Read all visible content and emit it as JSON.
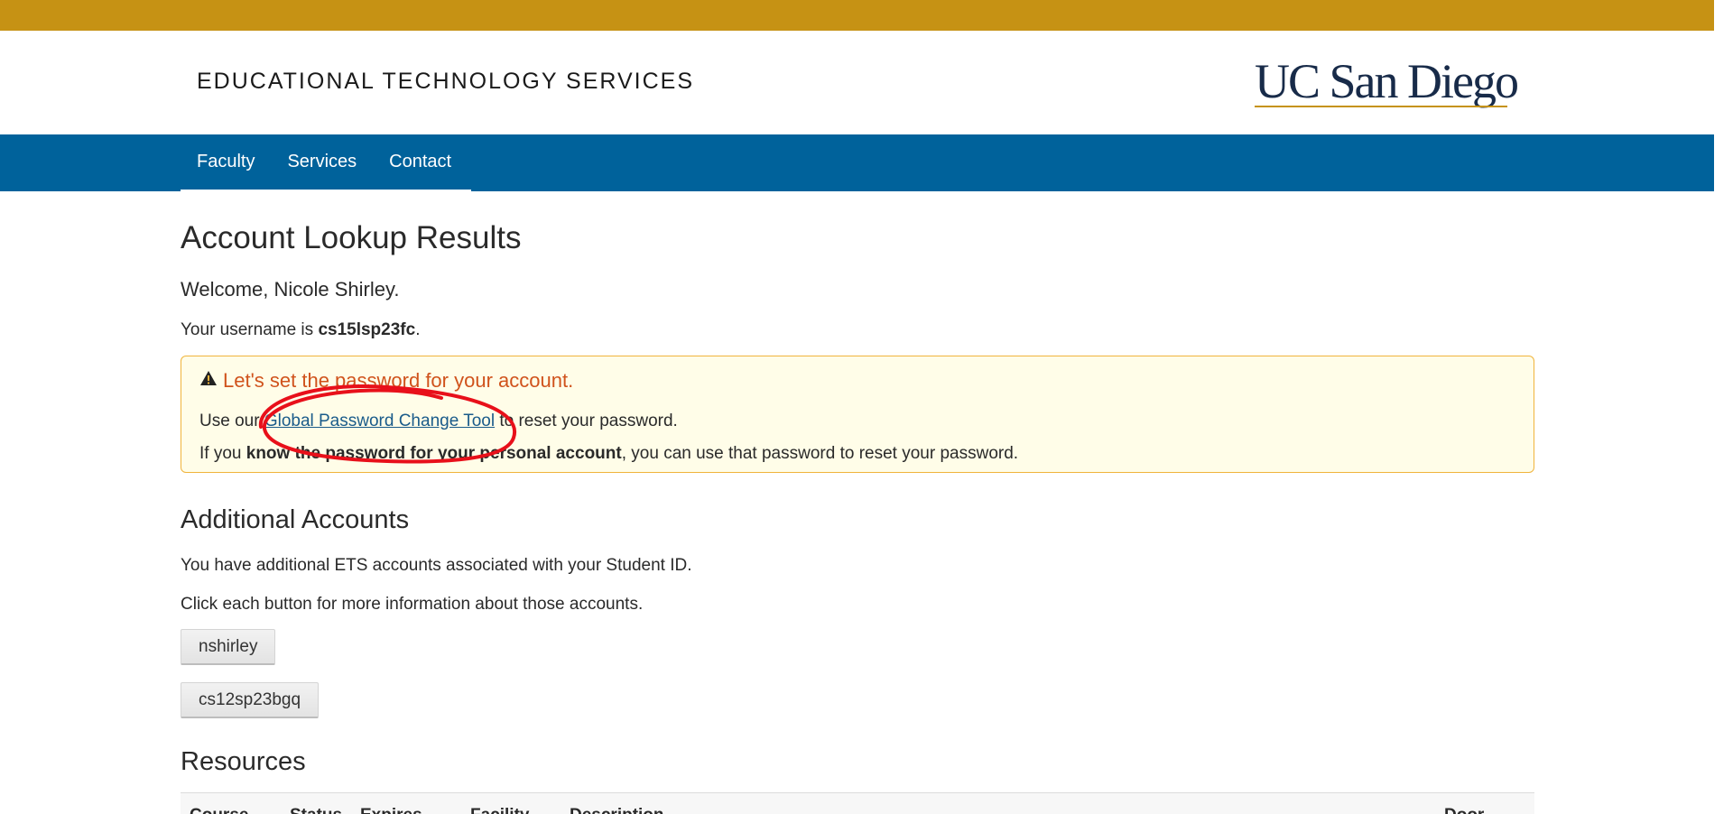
{
  "header": {
    "site_title": "EDUCATIONAL TECHNOLOGY SERVICES",
    "logo_text": "UC San Diego"
  },
  "nav": {
    "items": [
      {
        "label": "Faculty"
      },
      {
        "label": "Services"
      },
      {
        "label": "Contact"
      }
    ]
  },
  "main": {
    "title": "Account Lookup Results",
    "welcome": "Welcome, Nicole Shirley.",
    "username_prefix": "Your username is ",
    "username": "cs15lsp23fc",
    "username_suffix": ".",
    "alert": {
      "icon": "warning-icon",
      "title": "Let's set the password for your account.",
      "line1_prefix": "Use our ",
      "line1_link": "Global Password Change Tool",
      "line1_suffix": " to reset your password.",
      "line2_prefix": "If you ",
      "line2_bold": "know the password for your personal account",
      "line2_suffix": ", you can use that password to reset your password."
    },
    "additional": {
      "heading": "Additional Accounts",
      "text1": "You have additional ETS accounts associated with your Student ID.",
      "text2": "Click each button for more information about those accounts.",
      "accounts": [
        {
          "label": "nshirley"
        },
        {
          "label": "cs12sp23bgq"
        }
      ]
    },
    "resources": {
      "heading": "Resources",
      "columns": [
        "Course",
        "Status",
        "Expires",
        "Facility",
        "Description",
        "Door"
      ]
    }
  },
  "colors": {
    "gold_bar": "#c69214",
    "nav_bar": "#00629b",
    "alert_bg": "#fffde8",
    "alert_border": "#f0b43c",
    "alert_title": "#d0531c",
    "annotation_red": "#e8101a",
    "logo_navy": "#182b49"
  }
}
